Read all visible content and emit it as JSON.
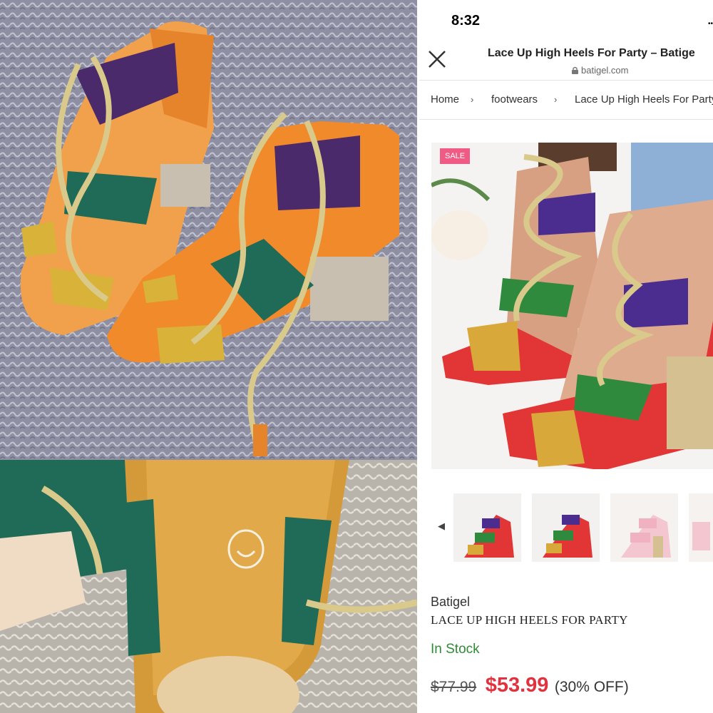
{
  "status_bar": {
    "time": "8:32",
    "signal": "••"
  },
  "browser": {
    "title": "Lace Up High Heels For Party – Batige",
    "url": "batigel.com"
  },
  "breadcrumb": [
    "Home",
    "footwears",
    "Lace Up High Heels For Party"
  ],
  "breadcrumb_separator": "›",
  "product": {
    "sale_badge": "SALE",
    "brand": "Batigel",
    "name": "LACE UP HIGH HEELS FOR PARTY",
    "stock_status": "In Stock",
    "original_price": "$77.99",
    "sale_price": "$53.99",
    "discount": "(30% OFF)"
  },
  "gallery_prev": "◀",
  "colors": {
    "accent_sale": "#e1323f",
    "in_stock": "#2e8b36",
    "sale_badge": "#f05b85"
  }
}
